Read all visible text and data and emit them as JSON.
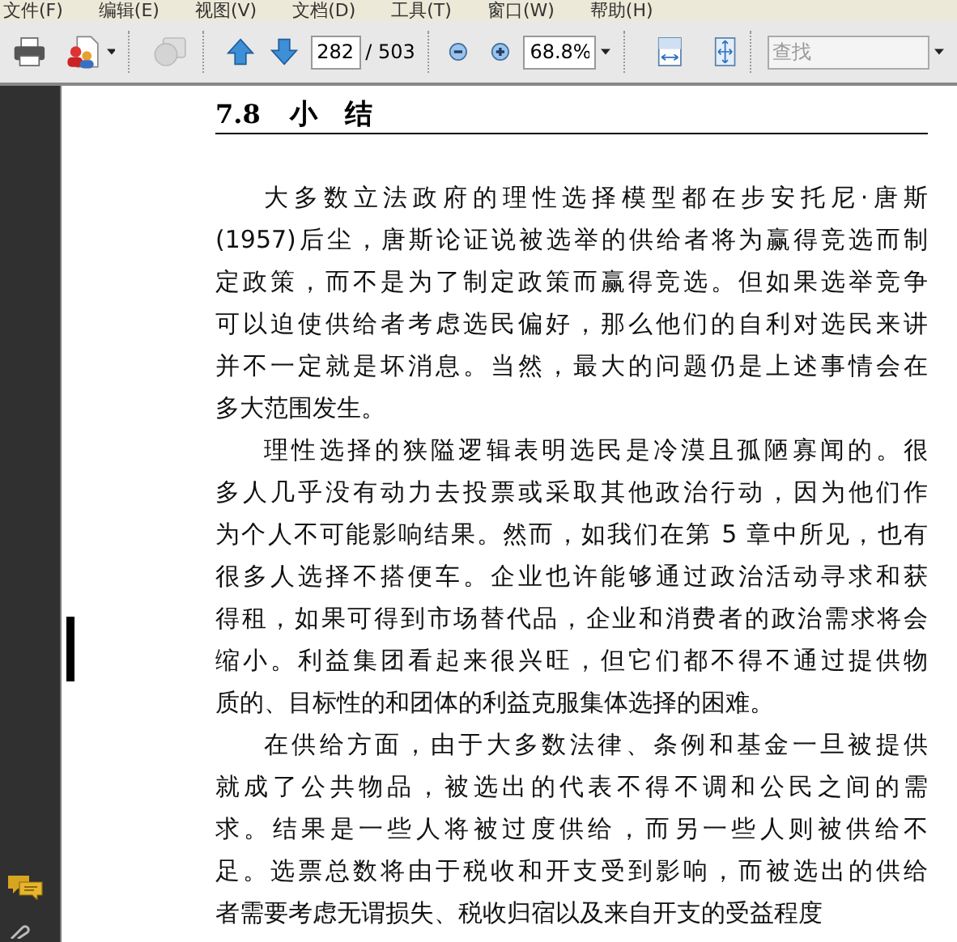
{
  "menu_bar": [
    "文件(F)",
    "编辑(E)",
    "视图(V)",
    "文档(D)",
    "工具(T)",
    "窗口(W)",
    "帮助(H)"
  ],
  "toolbar": {
    "collaborate_disabled": true,
    "page_number": "282",
    "page_count": "/ 503",
    "zoom": "68.8%",
    "search": {
      "placeholder": "查找"
    }
  },
  "document": {
    "heading": {
      "number": "7.8",
      "title": "小　结"
    },
    "paragraphs": [
      {
        "lines": [
          "大多数立法政府的理性选择模型都在步安托尼·唐斯",
          "(1957)后尘，唐斯论证说被选举的供给者将为赢得竞选而制",
          "定政策，而不是为了制定政策而赢得竞选。但如果选举竞争",
          "可以迫使供给者考虑选民偏好，那么他们的自利对选民来讲",
          "并不一定就是坏消息。当然，最大的问题仍是上述事情会在",
          "多大范围发生。"
        ]
      },
      {
        "lines": [
          "理性选择的狭隘逻辑表明选民是冷漠且孤陋寡闻的。很",
          "多人几乎没有动力去投票或采取其他政治行动，因为他们作",
          "为个人不可能影响结果。然而，如我们在第 5 章中所见，也有",
          "很多人选择不搭便车。企业也许能够通过政治活动寻求和获",
          "得租，如果可得到市场替代品，企业和消费者的政治需求将会",
          "缩小。利益集团看起来很兴旺，但它们都不得不通过提供物",
          "质的、目标性的和团体的利益克服集体选择的困难。"
        ]
      },
      {
        "lines": [
          "在供给方面，由于大多数法律、条例和基金一旦被提供",
          "就成了公共物品，被选出的代表不得不调和公民之间的需",
          "求。结果是一些人将被过度供给，而另一些人则被供给不",
          "足。选票总数将由于税收和开支受到影响，而被选出的供给",
          "者需要考虑无谓损失、税收归宿以及来自开支的受益程度"
        ]
      }
    ]
  }
}
